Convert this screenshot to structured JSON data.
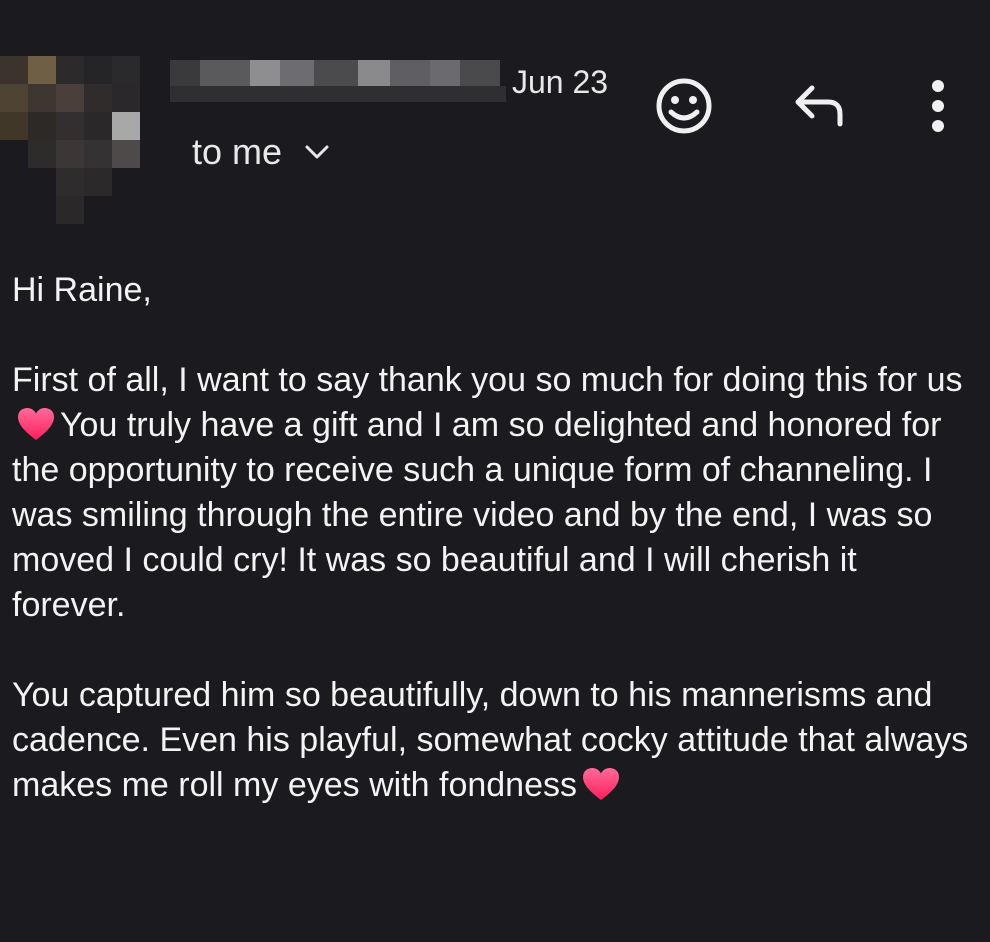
{
  "header": {
    "date": "Jun 23",
    "recipient_label": "to me",
    "icons": {
      "chevron": "chevron-down-icon",
      "emoji": "smiley-icon",
      "reply": "reply-icon",
      "more": "more-vertical-icon"
    }
  },
  "body": {
    "greeting": "Hi Raine,",
    "p1_part1": "First of all, I want to say thank you so much for doing this for us",
    "p1_part2": "You truly have a gift and I am so delighted and honored for the opportunity to receive such a unique form of channeling. I was smiling through the entire video and by the end, I was so moved I could cry! It was so beautiful and I will cherish it forever.",
    "p2": "You captured him so beautifully, down to his mannerisms and cadence. Even his playful, somewhat cocky attitude that always makes me roll my eyes with fondness"
  },
  "colors": {
    "background": "#1b1a1e",
    "text": "#f3f3f3",
    "heart": "#ff2f6e"
  }
}
